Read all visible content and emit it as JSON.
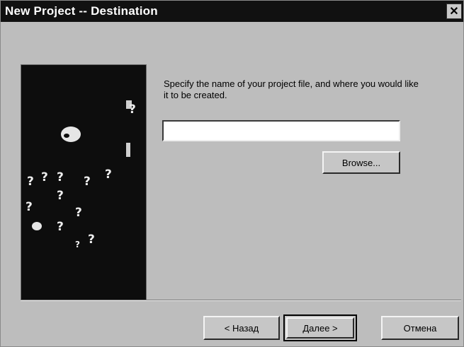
{
  "window": {
    "title": "New Project -- Destination",
    "close_glyph": "✕"
  },
  "prompt": {
    "text": "Specify the name of your project file, and where you would like it to be created."
  },
  "name_field": {
    "value": "",
    "placeholder": ""
  },
  "buttons": {
    "browse_label": "Browse...",
    "back_label": "< Назад",
    "next_label": "Далее >",
    "cancel_label": "Отмена"
  },
  "illustration": {
    "description_icon": "question-marks-illustration",
    "glyph": "?"
  },
  "colors": {
    "title_bar": "#111111",
    "dialog_face": "#bdbdbd",
    "illustration_bg": "#0d0d0d"
  }
}
